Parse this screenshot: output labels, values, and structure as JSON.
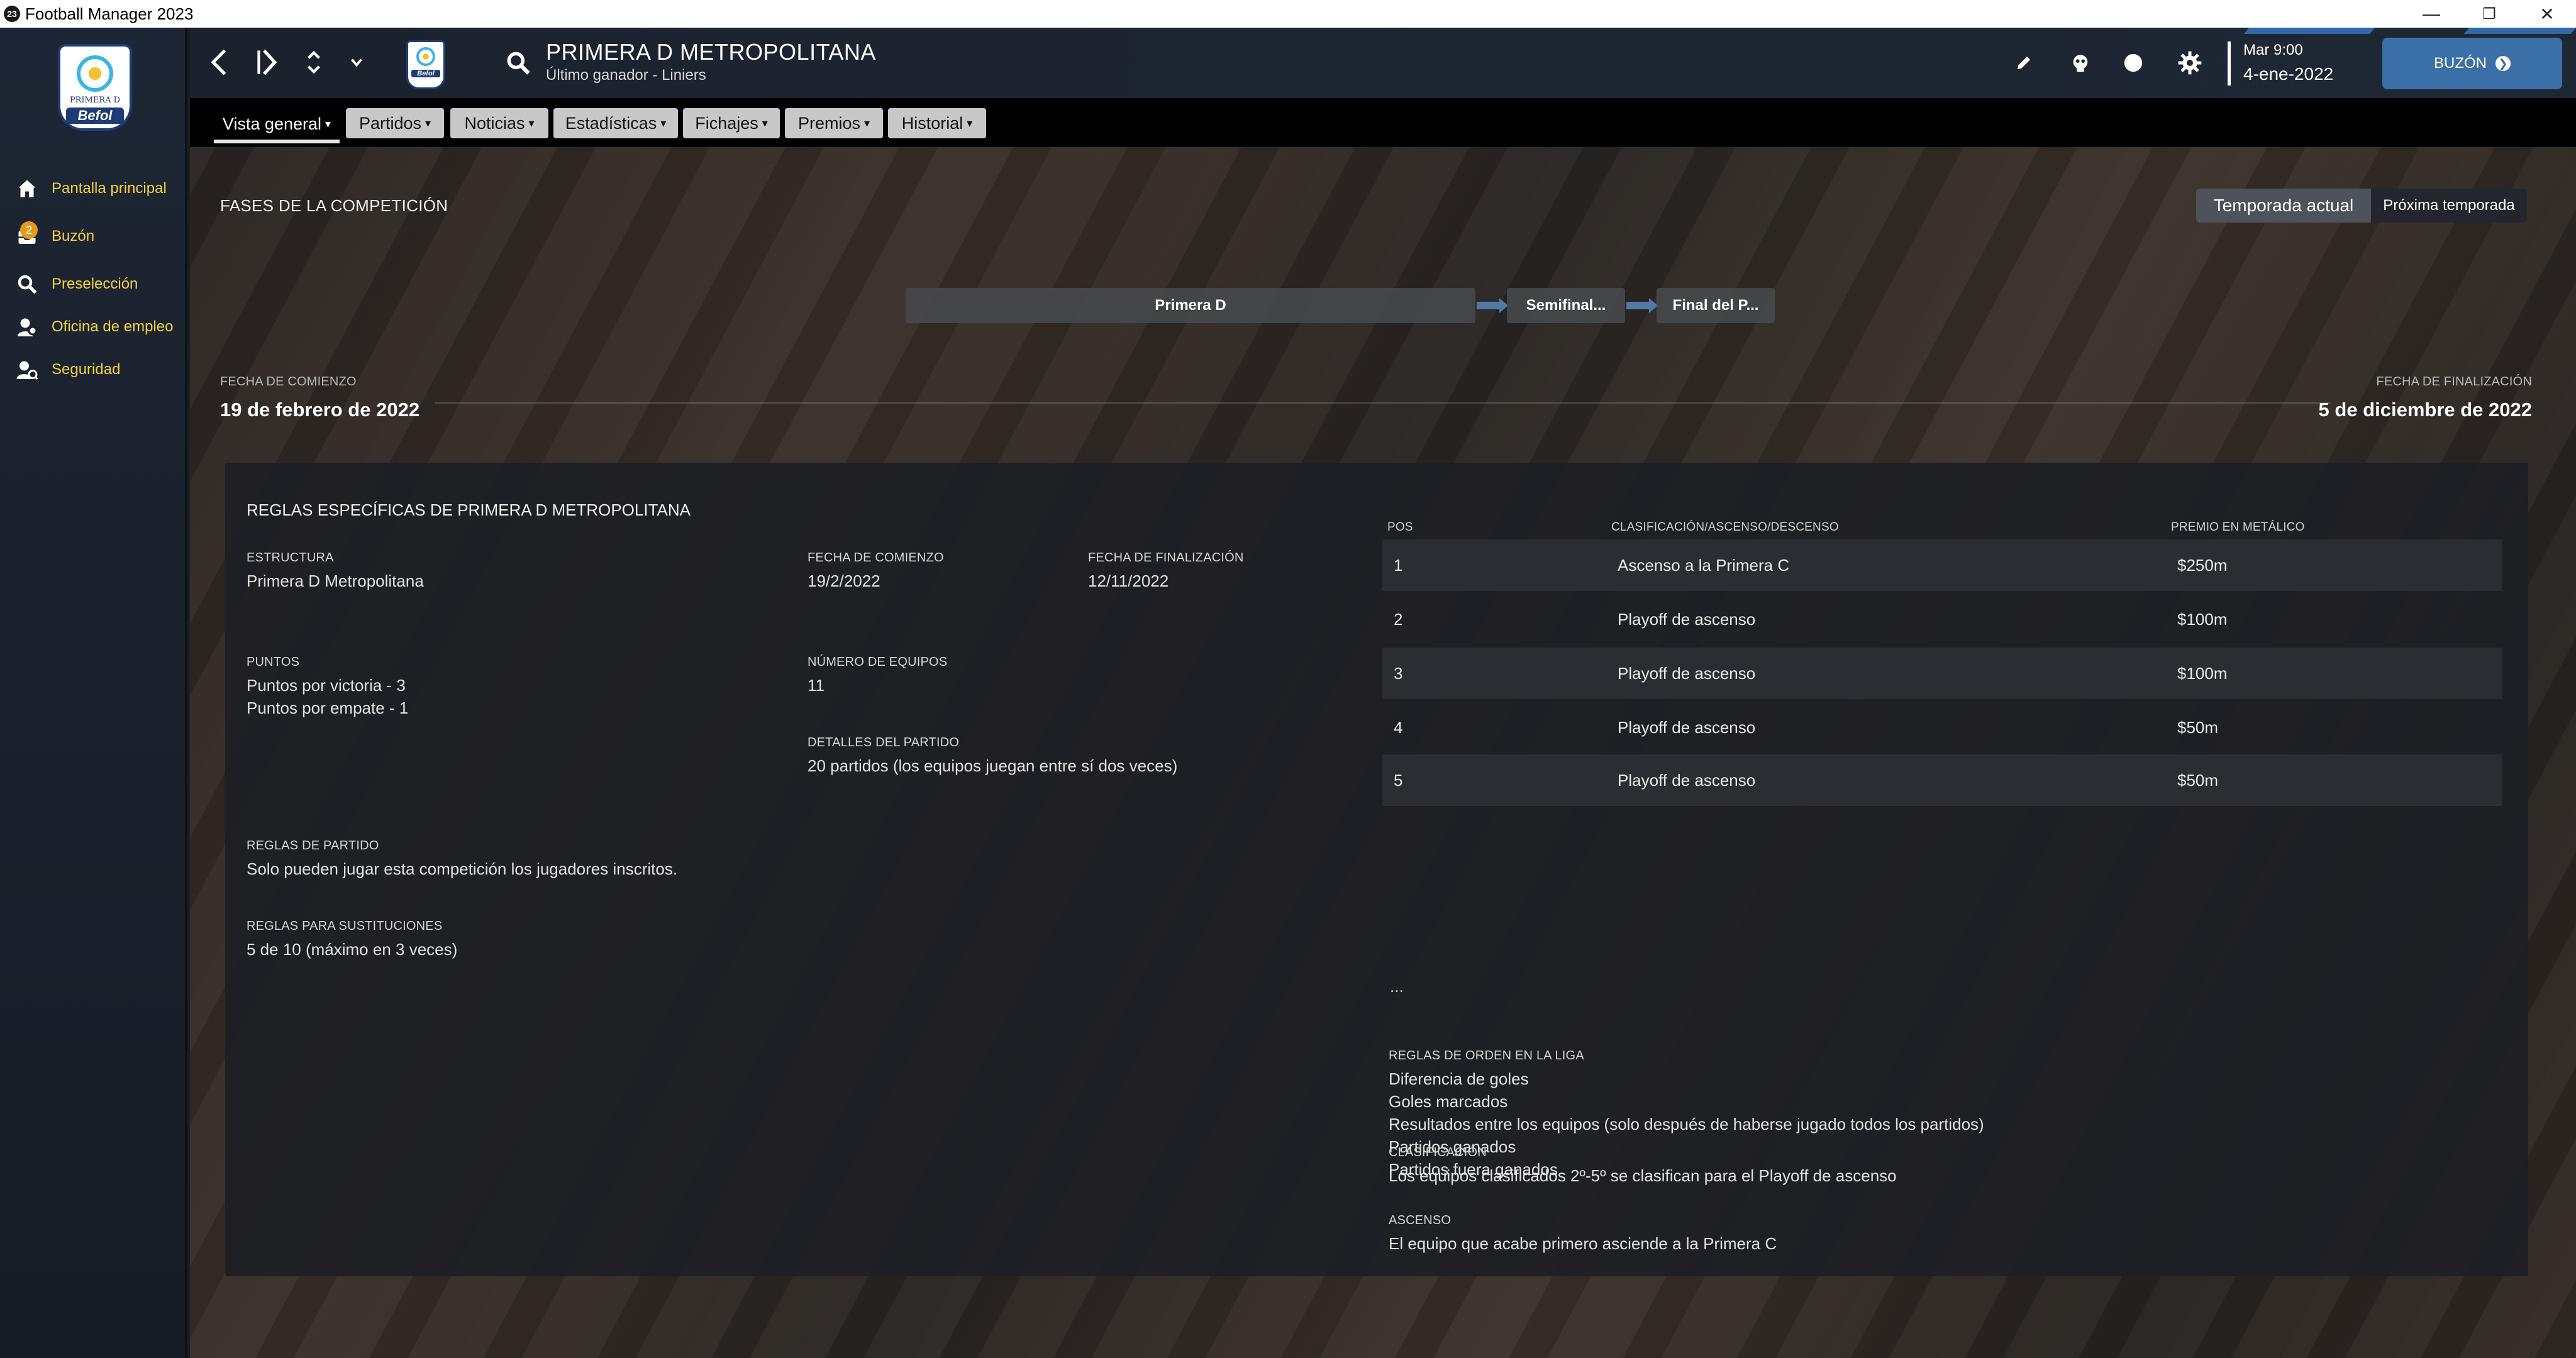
{
  "window": {
    "app_icon": "23",
    "title": "Football Manager 2023",
    "controls": [
      "—",
      "❐",
      "✕"
    ]
  },
  "sidebar": {
    "logo": {
      "sub": "PRIMERA D",
      "brand": "Befol"
    },
    "items": [
      {
        "label": "Pantalla principal",
        "icon": "home-icon"
      },
      {
        "label": "Buzón",
        "icon": "inbox-icon",
        "badge": "2"
      },
      {
        "label": "Preselección",
        "icon": "search-icon"
      },
      {
        "label": "Oficina de empleo",
        "icon": "job-office-icon"
      },
      {
        "label": "Seguridad",
        "icon": "security-icon"
      }
    ]
  },
  "header": {
    "competition_title": "PRIMERA D METROPOLITANA",
    "competition_subtitle": "Último ganador - Liniers",
    "crest_brand": "Befol",
    "time": "Mar 9:00",
    "date": "4-ene-2022",
    "continue_label": "BUZÓN",
    "continue_arrow": "❯"
  },
  "tabs": [
    {
      "label": "Vista general",
      "active": true
    },
    {
      "label": "Partidos"
    },
    {
      "label": "Noticias"
    },
    {
      "label": "Estadísticas"
    },
    {
      "label": "Fichajes"
    },
    {
      "label": "Premios"
    },
    {
      "label": "Historial"
    }
  ],
  "phases": {
    "title": "FASES DE LA COMPETICIÓN",
    "season_current": "Temporada actual",
    "season_next": "Próxima temporada",
    "stages": [
      "Primera D",
      "Semifinal...",
      "Final del P..."
    ],
    "start_label": "FECHA DE COMIENZO",
    "start_date": "19 de febrero de 2022",
    "end_label": "FECHA DE FINALIZACIÓN",
    "end_date": "5 de diciembre de 2022"
  },
  "rules": {
    "title": "REGLAS ESPECÍFICAS DE PRIMERA D METROPOLITANA",
    "structure_label": "ESTRUCTURA",
    "structure_value": "Primera D Metropolitana",
    "start_label": "FECHA DE COMIENZO",
    "start_value": "19/2/2022",
    "end_label": "FECHA DE FINALIZACIÓN",
    "end_value": "12/11/2022",
    "points_label": "PUNTOS",
    "points_win": "Puntos por victoria - 3",
    "points_draw": "Puntos por empate - 1",
    "teams_label": "NÚMERO DE EQUIPOS",
    "teams_value": "11",
    "match_details_label": "DETALLES DEL PARTIDO",
    "match_details_value": "20 partidos (los equipos juegan entre sí dos veces)",
    "match_rules_label": "REGLAS DE PARTIDO",
    "match_rules_value": "Solo pueden jugar esta competición los jugadores inscritos.",
    "subs_label": "REGLAS PARA SUSTITUCIONES",
    "subs_value": "5 de 10 (máximo en 3 veces)",
    "table_headers": {
      "pos": "POS",
      "classification": "CLASIFICACIÓN/ASCENSO/DESCENSO",
      "prize": "PREMIO EN METÁLICO"
    },
    "table_rows": [
      {
        "pos": "1",
        "classification": "Ascenso a la Primera C",
        "prize": "$250m"
      },
      {
        "pos": "2",
        "classification": "Playoff de ascenso",
        "prize": "$100m"
      },
      {
        "pos": "3",
        "classification": "Playoff de ascenso",
        "prize": "$100m"
      },
      {
        "pos": "4",
        "classification": "Playoff de ascenso",
        "prize": "$50m"
      },
      {
        "pos": "5",
        "classification": "Playoff de ascenso",
        "prize": "$50m"
      }
    ],
    "table_more": "...",
    "order_label": "REGLAS DE ORDEN EN LA LIGA",
    "order_items": [
      "Diferencia de goles",
      "Goles marcados",
      "Resultados entre los equipos (solo después de haberse jugado todos los partidos)",
      "Partidos ganados",
      "Partidos fuera ganados"
    ],
    "promotion_label": "ASCENSO",
    "promotion_value": "El equipo que acabe primero asciende a la Primera C",
    "qualification_label": "CLASIFICACIÓN",
    "qualification_value": "Los equipos clasificados 2º-5º se clasifican para el Playoff de ascenso"
  }
}
